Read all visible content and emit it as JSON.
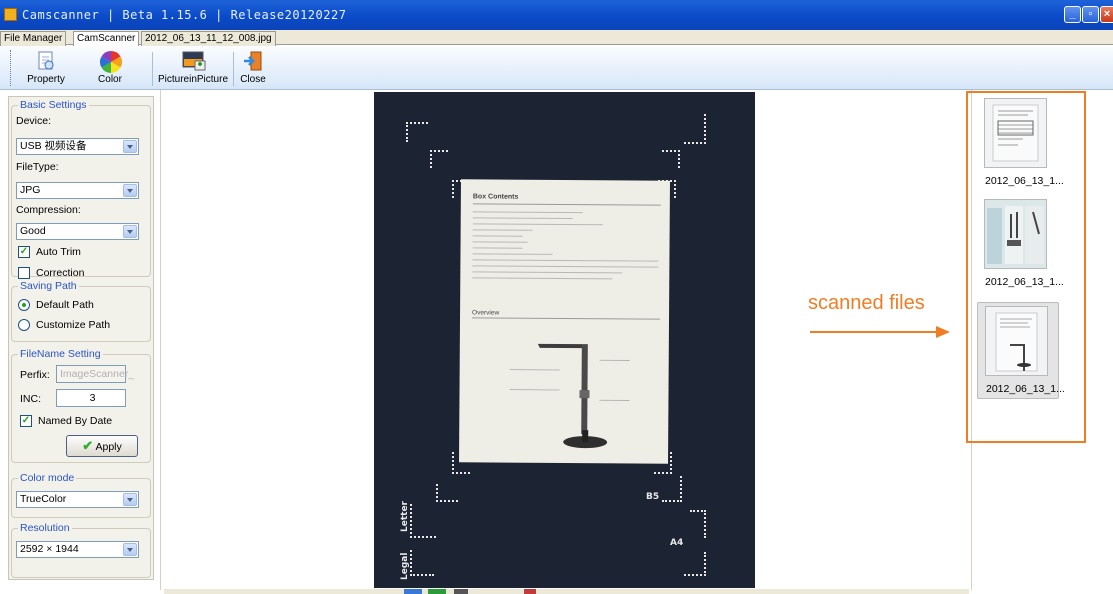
{
  "window": {
    "title": "Camscanner | Beta 1.15.6 | Release20120227",
    "controls": [
      "minimize",
      "maximize",
      "close"
    ]
  },
  "tabs": [
    {
      "label": "File Manager",
      "active": false
    },
    {
      "label": "CamScanner",
      "active": true
    },
    {
      "label": "2012_06_13_11_12_008.jpg",
      "active": false
    }
  ],
  "toolbar": {
    "property_label": "Property",
    "color_label": "Color",
    "pip_label": "PictureinPicture",
    "close_label": "Close"
  },
  "basic_settings": {
    "title": "Basic Settings",
    "device_label": "Device:",
    "device_value": "USB 视频设备",
    "filetype_label": "FileType:",
    "filetype_value": "JPG",
    "compression_label": "Compression:",
    "compression_value": "Good",
    "auto_trim_label": "Auto Trim",
    "auto_trim_checked": true,
    "correction_label": "Correction",
    "correction_checked": false
  },
  "saving_path": {
    "title": "Saving Path",
    "default_label": "Default Path",
    "customize_label": "Customize Path",
    "selected": "default"
  },
  "filename_setting": {
    "title": "FileName Setting",
    "prefix_label": "Perfix:",
    "prefix_value": "ImageScanner_",
    "inc_label": "INC:",
    "inc_value": "3",
    "named_by_date_label": "Named By Date",
    "named_by_date_checked": true,
    "apply_label": "Apply"
  },
  "color_mode": {
    "title": "Color mode",
    "value": "TrueColor"
  },
  "resolution": {
    "title": "Resolution",
    "value": "2592 × 1944"
  },
  "preview": {
    "letter_label": "Letter",
    "legal_label": "Legal",
    "b5_label": "B5",
    "a4_label": "A4",
    "doc_heading_1": "Box Contents",
    "doc_heading_2": "Overview"
  },
  "thumbnails": [
    {
      "name": "2012_06_13_1...",
      "selected": false
    },
    {
      "name": "2012_06_13_1...",
      "selected": false
    },
    {
      "name": "2012_06_13_1...",
      "selected": true
    }
  ],
  "annotation": {
    "text": "scanned files",
    "color": "#f07c23"
  }
}
